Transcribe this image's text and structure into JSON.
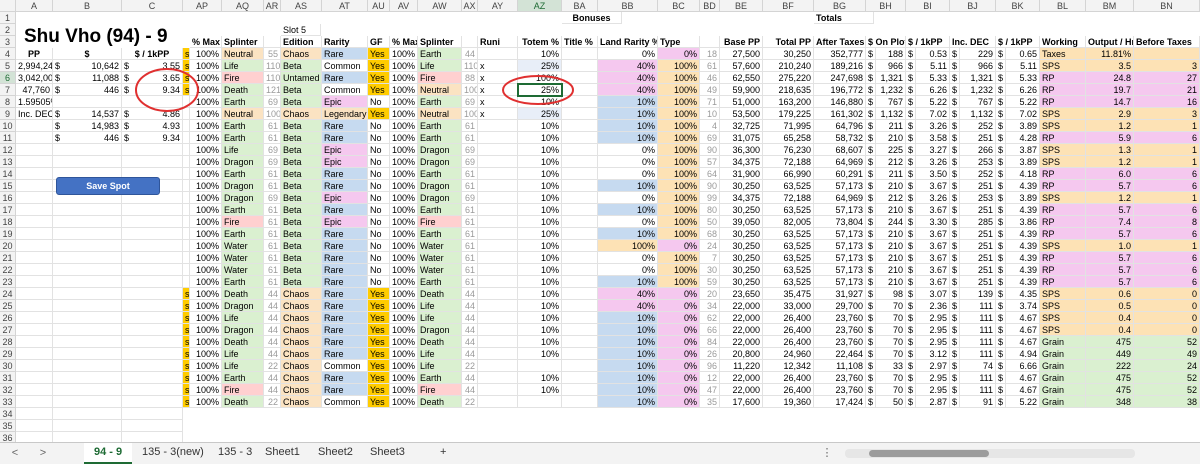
{
  "title": "Shu Vho (94) - 9",
  "save_button": "Save Spot",
  "colors": {
    "neutral": "#fbe3c2",
    "life": "#daf0d0",
    "fire": "#ffd0d0",
    "death": "#daf0d0",
    "earth": "#daf0d0",
    "dragon": "#daf0d0",
    "water": "#daf0d0",
    "chaos": "#fbe3c2",
    "rare": "#c6daf0",
    "common": "#ffffff",
    "epic": "#f5c8ef",
    "legendary": "#fbe3c2",
    "yes": "#ffcc00",
    "pink": "#f5c8ef",
    "blue": "#c6daf0",
    "orange": "#fde2b5",
    "green": "#daf0d0"
  },
  "columns": [
    "A",
    "B",
    "C",
    "AP",
    "AQ",
    "AR",
    "AS",
    "AT",
    "AU",
    "AV",
    "AW",
    "AX",
    "AY",
    "AZ",
    "BA",
    "BB",
    "BC",
    "BD",
    "BE",
    "BF",
    "BG",
    "BH",
    "BI",
    "BJ",
    "BK",
    "BL",
    "BM",
    "BN"
  ],
  "header_row1": {
    "bonuses": "Bonuses",
    "totals": "Totals"
  },
  "header_row2": {
    "slot5": "Slot 5"
  },
  "header_row3": [
    "% Max",
    "Splinter",
    "",
    "Edition",
    "Rarity",
    "GF",
    "% Max",
    "Splinter",
    "",
    "Runi",
    "Totem %",
    "Title %",
    "Land Rarity %",
    "Type",
    "",
    "Base PP",
    "Total PP",
    "After Taxes",
    "$ On Plot",
    "$ / 1kPP",
    "Inc. DEC",
    "$ / 1kPP",
    "Working",
    "Output / Hr",
    "Before Taxes"
  ],
  "header_row4": {
    "pp": "PP",
    "dollar": "$",
    "dollar_per": "$ / 1kPP",
    "taxes": "Taxes",
    "taxes_pct": "11.81%"
  },
  "left_rows": [
    {
      "pp": "2,994,248",
      "d": "$",
      "dv": "10,642",
      "d2": "$",
      "dper": "3.55"
    },
    {
      "pp": "3,042,008",
      "d": "$",
      "dv": "11,088",
      "d2": "$",
      "dper": "3.65"
    },
    {
      "pp": "47,760",
      "d": "$",
      "dv": "446",
      "d2": "$",
      "dper": "9.34"
    },
    {
      "pp": "1.59505%",
      "d": "",
      "dv": "",
      "d2": "",
      "dper": ""
    },
    {
      "pp": "Inc. DEC",
      "d": "$",
      "dv": "14,537",
      "d2": "$",
      "dper": "4.86"
    },
    {
      "pp": "",
      "d": "$",
      "dv": "14,983",
      "d2": "$",
      "dper": "4.93"
    },
    {
      "pp": "",
      "d": "$",
      "dv": "446",
      "d2": "$",
      "dper": "9.34"
    }
  ],
  "rows": [
    [
      "s",
      "100%",
      "Neutral",
      "55",
      "Chaos",
      "Rare",
      "Yes",
      "100%",
      "Earth",
      "44",
      "",
      "10%",
      "",
      "0%",
      "0%",
      "18",
      "27,500",
      "30,250",
      "352,777",
      "$",
      "188",
      "$",
      "0.53",
      "$",
      "229",
      "$",
      "0.65",
      "Taxes",
      "11.81%",
      ""
    ],
    [
      "s",
      "100%",
      "Life",
      "110",
      "Beta",
      "Common",
      "Yes",
      "100%",
      "Life",
      "110",
      "x",
      "25%",
      "",
      "40%",
      "100%",
      "61",
      "57,600",
      "210,240",
      "189,216",
      "$",
      "966",
      "$",
      "5.11",
      "$",
      "966",
      "$",
      "5.11",
      "SPS",
      "3.5",
      "3"
    ],
    [
      "s",
      "100%",
      "Fire",
      "110",
      "Untamed",
      "Rare",
      "Yes",
      "100%",
      "Fire",
      "88",
      "x",
      "100%",
      "",
      "40%",
      "100%",
      "46",
      "62,550",
      "275,220",
      "247,698",
      "$",
      "1,321",
      "$",
      "5.33",
      "$",
      "1,321",
      "$",
      "5.33",
      "RP",
      "24.8",
      "27"
    ],
    [
      "s",
      "100%",
      "Death",
      "121",
      "Beta",
      "Common",
      "Yes",
      "100%",
      "Neutral",
      "100",
      "x",
      "25%",
      "",
      "40%",
      "100%",
      "49",
      "59,900",
      "218,635",
      "196,772",
      "$",
      "1,232",
      "$",
      "6.26",
      "$",
      "1,232",
      "$",
      "6.26",
      "RP",
      "19.7",
      "21"
    ],
    [
      "",
      "100%",
      "Earth",
      "69",
      "Beta",
      "Epic",
      "No",
      "100%",
      "Earth",
      "69",
      "x",
      "10%",
      "",
      "10%",
      "100%",
      "71",
      "51,000",
      "163,200",
      "146,880",
      "$",
      "767",
      "$",
      "5.22",
      "$",
      "767",
      "$",
      "5.22",
      "RP",
      "14.7",
      "16"
    ],
    [
      "",
      "100%",
      "Neutral",
      "100",
      "Chaos",
      "Legendary",
      "Yes",
      "100%",
      "Neutral",
      "100",
      "x",
      "25%",
      "",
      "10%",
      "100%",
      "10",
      "53,500",
      "179,225",
      "161,302",
      "$",
      "1,132",
      "$",
      "7.02",
      "$",
      "1,132",
      "$",
      "7.02",
      "SPS",
      "2.9",
      "3"
    ],
    [
      "",
      "100%",
      "Earth",
      "61",
      "Beta",
      "Rare",
      "No",
      "100%",
      "Earth",
      "61",
      "",
      "10%",
      "",
      "10%",
      "100%",
      "4",
      "32,725",
      "71,995",
      "64,796",
      "$",
      "211",
      "$",
      "3.26",
      "$",
      "252",
      "$",
      "3.89",
      "SPS",
      "1.2",
      "1"
    ],
    [
      "",
      "100%",
      "Earth",
      "61",
      "Beta",
      "Rare",
      "No",
      "100%",
      "Earth",
      "61",
      "",
      "10%",
      "",
      "10%",
      "100%",
      "69",
      "31,075",
      "65,258",
      "58,732",
      "$",
      "210",
      "$",
      "3.58",
      "$",
      "251",
      "$",
      "4.28",
      "RP",
      "5.9",
      "6"
    ],
    [
      "",
      "100%",
      "Life",
      "69",
      "Beta",
      "Epic",
      "No",
      "100%",
      "Dragon",
      "69",
      "",
      "10%",
      "",
      "0%",
      "100%",
      "90",
      "36,300",
      "76,230",
      "68,607",
      "$",
      "225",
      "$",
      "3.27",
      "$",
      "266",
      "$",
      "3.87",
      "SPS",
      "1.3",
      "1"
    ],
    [
      "",
      "100%",
      "Dragon",
      "69",
      "Beta",
      "Epic",
      "No",
      "100%",
      "Dragon",
      "69",
      "",
      "10%",
      "",
      "0%",
      "100%",
      "57",
      "34,375",
      "72,188",
      "64,969",
      "$",
      "212",
      "$",
      "3.26",
      "$",
      "253",
      "$",
      "3.89",
      "SPS",
      "1.2",
      "1"
    ],
    [
      "",
      "100%",
      "Earth",
      "61",
      "Beta",
      "Rare",
      "No",
      "100%",
      "Earth",
      "61",
      "",
      "10%",
      "",
      "0%",
      "100%",
      "64",
      "31,900",
      "66,990",
      "60,291",
      "$",
      "211",
      "$",
      "3.50",
      "$",
      "252",
      "$",
      "4.18",
      "RP",
      "6.0",
      "6"
    ],
    [
      "",
      "100%",
      "Dragon",
      "61",
      "Beta",
      "Rare",
      "No",
      "100%",
      "Dragon",
      "61",
      "",
      "10%",
      "",
      "10%",
      "100%",
      "90",
      "30,250",
      "63,525",
      "57,173",
      "$",
      "210",
      "$",
      "3.67",
      "$",
      "251",
      "$",
      "4.39",
      "RP",
      "5.7",
      "6"
    ],
    [
      "",
      "100%",
      "Dragon",
      "69",
      "Beta",
      "Epic",
      "No",
      "100%",
      "Dragon",
      "69",
      "",
      "10%",
      "",
      "0%",
      "100%",
      "99",
      "34,375",
      "72,188",
      "64,969",
      "$",
      "212",
      "$",
      "3.26",
      "$",
      "253",
      "$",
      "3.89",
      "SPS",
      "1.2",
      "1"
    ],
    [
      "",
      "100%",
      "Earth",
      "61",
      "Beta",
      "Rare",
      "No",
      "100%",
      "Earth",
      "61",
      "",
      "10%",
      "",
      "10%",
      "100%",
      "80",
      "30,250",
      "63,525",
      "57,173",
      "$",
      "210",
      "$",
      "3.67",
      "$",
      "251",
      "$",
      "4.39",
      "RP",
      "5.7",
      "6"
    ],
    [
      "",
      "100%",
      "Fire",
      "61",
      "Beta",
      "Epic",
      "No",
      "100%",
      "Fire",
      "61",
      "",
      "10%",
      "",
      "0%",
      "100%",
      "50",
      "39,050",
      "82,005",
      "73,804",
      "$",
      "244",
      "$",
      "3.30",
      "$",
      "285",
      "$",
      "3.86",
      "RP",
      "7.4",
      "8"
    ],
    [
      "",
      "100%",
      "Earth",
      "61",
      "Beta",
      "Rare",
      "No",
      "100%",
      "Earth",
      "61",
      "",
      "10%",
      "",
      "10%",
      "100%",
      "68",
      "30,250",
      "63,525",
      "57,173",
      "$",
      "210",
      "$",
      "3.67",
      "$",
      "251",
      "$",
      "4.39",
      "RP",
      "5.7",
      "6"
    ],
    [
      "",
      "100%",
      "Water",
      "61",
      "Beta",
      "Rare",
      "No",
      "100%",
      "Water",
      "61",
      "",
      "10%",
      "",
      "100%",
      "0%",
      "24",
      "30,250",
      "63,525",
      "57,173",
      "$",
      "210",
      "$",
      "3.67",
      "$",
      "251",
      "$",
      "4.39",
      "SPS",
      "1.0",
      "1"
    ],
    [
      "",
      "100%",
      "Water",
      "61",
      "Beta",
      "Rare",
      "No",
      "100%",
      "Water",
      "61",
      "",
      "10%",
      "",
      "0%",
      "100%",
      "7",
      "30,250",
      "63,525",
      "57,173",
      "$",
      "210",
      "$",
      "3.67",
      "$",
      "251",
      "$",
      "4.39",
      "RP",
      "5.7",
      "6"
    ],
    [
      "",
      "100%",
      "Water",
      "61",
      "Beta",
      "Rare",
      "No",
      "100%",
      "Water",
      "61",
      "",
      "10%",
      "",
      "0%",
      "100%",
      "30",
      "30,250",
      "63,525",
      "57,173",
      "$",
      "210",
      "$",
      "3.67",
      "$",
      "251",
      "$",
      "4.39",
      "RP",
      "5.7",
      "6"
    ],
    [
      "",
      "100%",
      "Earth",
      "61",
      "Beta",
      "Rare",
      "No",
      "100%",
      "Earth",
      "61",
      "",
      "10%",
      "",
      "10%",
      "100%",
      "59",
      "30,250",
      "63,525",
      "57,173",
      "$",
      "210",
      "$",
      "3.67",
      "$",
      "251",
      "$",
      "4.39",
      "RP",
      "5.7",
      "6"
    ],
    [
      "s",
      "100%",
      "Death",
      "44",
      "Chaos",
      "Rare",
      "Yes",
      "100%",
      "Death",
      "44",
      "",
      "10%",
      "",
      "40%",
      "0%",
      "20",
      "23,650",
      "35,475",
      "31,927",
      "$",
      "98",
      "$",
      "3.07",
      "$",
      "139",
      "$",
      "4.35",
      "SPS",
      "0.6",
      "0"
    ],
    [
      "s",
      "100%",
      "Dragon",
      "44",
      "Chaos",
      "Rare",
      "Yes",
      "100%",
      "Life",
      "44",
      "",
      "10%",
      "",
      "40%",
      "0%",
      "34",
      "22,000",
      "33,000",
      "29,700",
      "$",
      "70",
      "$",
      "2.36",
      "$",
      "111",
      "$",
      "3.74",
      "SPS",
      "0.5",
      "0"
    ],
    [
      "s",
      "100%",
      "Life",
      "44",
      "Chaos",
      "Rare",
      "Yes",
      "100%",
      "Life",
      "44",
      "",
      "10%",
      "",
      "10%",
      "0%",
      "62",
      "22,000",
      "26,400",
      "23,760",
      "$",
      "70",
      "$",
      "2.95",
      "$",
      "111",
      "$",
      "4.67",
      "SPS",
      "0.4",
      "0"
    ],
    [
      "s",
      "100%",
      "Dragon",
      "44",
      "Chaos",
      "Rare",
      "Yes",
      "100%",
      "Dragon",
      "44",
      "",
      "10%",
      "",
      "10%",
      "0%",
      "66",
      "22,000",
      "26,400",
      "23,760",
      "$",
      "70",
      "$",
      "2.95",
      "$",
      "111",
      "$",
      "4.67",
      "SPS",
      "0.4",
      "0"
    ],
    [
      "s",
      "100%",
      "Death",
      "44",
      "Chaos",
      "Rare",
      "Yes",
      "100%",
      "Death",
      "44",
      "",
      "10%",
      "",
      "10%",
      "0%",
      "84",
      "22,000",
      "26,400",
      "23,760",
      "$",
      "70",
      "$",
      "2.95",
      "$",
      "111",
      "$",
      "4.67",
      "Grain",
      "475",
      "52"
    ],
    [
      "s",
      "100%",
      "Life",
      "44",
      "Chaos",
      "Rare",
      "Yes",
      "100%",
      "Life",
      "44",
      "",
      "10%",
      "",
      "10%",
      "0%",
      "26",
      "20,800",
      "24,960",
      "22,464",
      "$",
      "70",
      "$",
      "3.12",
      "$",
      "111",
      "$",
      "4.94",
      "Grain",
      "449",
      "49"
    ],
    [
      "s",
      "100%",
      "Life",
      "22",
      "Chaos",
      "Common",
      "Yes",
      "100%",
      "Life",
      "22",
      "",
      "",
      "",
      "10%",
      "0%",
      "96",
      "11,220",
      "12,342",
      "11,108",
      "$",
      "33",
      "$",
      "2.97",
      "$",
      "74",
      "$",
      "6.66",
      "Grain",
      "222",
      "24"
    ],
    [
      "s",
      "100%",
      "Earth",
      "44",
      "Chaos",
      "Rare",
      "Yes",
      "100%",
      "Earth",
      "44",
      "",
      "10%",
      "",
      "10%",
      "0%",
      "12",
      "22,000",
      "26,400",
      "23,760",
      "$",
      "70",
      "$",
      "2.95",
      "$",
      "111",
      "$",
      "4.67",
      "Grain",
      "475",
      "52"
    ],
    [
      "s",
      "100%",
      "Fire",
      "44",
      "Chaos",
      "Rare",
      "Yes",
      "100%",
      "Fire",
      "44",
      "",
      "10%",
      "",
      "10%",
      "0%",
      "47",
      "22,000",
      "26,400",
      "23,760",
      "$",
      "70",
      "$",
      "2.95",
      "$",
      "111",
      "$",
      "4.67",
      "Grain",
      "475",
      "52"
    ],
    [
      "s",
      "100%",
      "Death",
      "22",
      "Chaos",
      "Common",
      "Yes",
      "100%",
      "Death",
      "22",
      "",
      "",
      "",
      "10%",
      "0%",
      "35",
      "17,600",
      "19,360",
      "17,424",
      "$",
      "50",
      "$",
      "2.87",
      "$",
      "91",
      "$",
      "5.22",
      "Grain",
      "348",
      "38"
    ]
  ],
  "tabs": [
    "94 - 9",
    "135 - 3(new)",
    "135 - 3",
    "Sheet1",
    "Sheet2",
    "Sheet3"
  ],
  "tab_add": "+",
  "nav_prev": "<",
  "nav_next": ">",
  "menu_dots": "⋮"
}
